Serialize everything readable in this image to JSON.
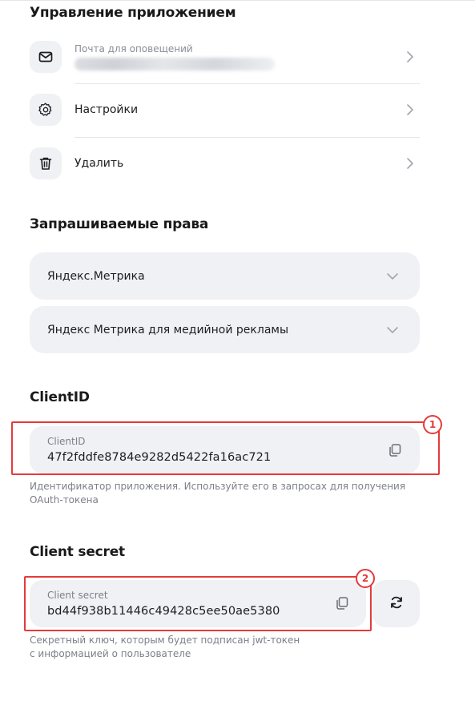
{
  "app_management": {
    "title": "Управление приложением",
    "items": [
      {
        "label": "Почта для оповещений",
        "icon": "mail-icon"
      },
      {
        "label": "Настройки",
        "icon": "gear-icon"
      },
      {
        "label": "Удалить",
        "icon": "trash-icon"
      }
    ]
  },
  "permissions": {
    "title": "Запрашиваемые права",
    "items": [
      {
        "label": "Яндекс.Метрика"
      },
      {
        "label": "Яндекс Метрика для медийной рекламы"
      }
    ]
  },
  "client_id": {
    "title": "ClientID",
    "field_label": "ClientID",
    "value": "47f2fddfe8784e9282d5422fa16ac721",
    "hint_line1": "Идентификатор приложения. Используйте его в запросах для получения",
    "hint_line2": "OAuth-токена",
    "badge": "1"
  },
  "client_secret": {
    "title": "Client secret",
    "field_label": "Client secret",
    "value": "bd44f938b11446c49428c5ee50ae5380",
    "hint_line1": "Секретный ключ, которым будет подписан jwt-токен",
    "hint_line2": "с информацией о пользователе",
    "badge": "2"
  },
  "colors": {
    "annotation": "#e53a3a",
    "field_bg": "#f0f1f4"
  }
}
